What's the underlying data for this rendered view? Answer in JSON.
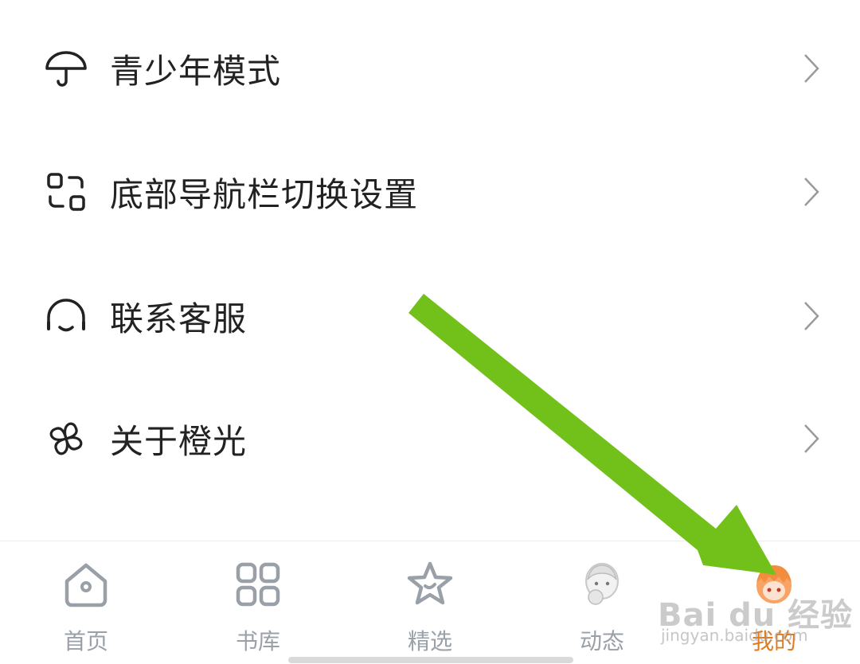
{
  "menu": {
    "items": [
      {
        "label": "青少年模式",
        "icon": "umbrella-icon"
      },
      {
        "label": "底部导航栏切换设置",
        "icon": "switch-icon"
      },
      {
        "label": "联系客服",
        "icon": "headset-icon"
      },
      {
        "label": "关于橙光",
        "icon": "clover-icon"
      }
    ]
  },
  "tabbar": {
    "tabs": [
      {
        "label": "首页",
        "icon": "home-icon"
      },
      {
        "label": "书库",
        "icon": "grid-icon"
      },
      {
        "label": "精选",
        "icon": "star-icon"
      },
      {
        "label": "动态",
        "icon": "avatar-icon"
      },
      {
        "label": "我的",
        "icon": "avatar-icon",
        "active": true
      }
    ]
  },
  "watermark": {
    "text": "Bai du 经验",
    "sub": "jingyan.baidu.com"
  },
  "colors": {
    "active_tab": "#e07b1e",
    "inactive_tab": "#9aa0a8",
    "arrow": "#72c01a"
  }
}
